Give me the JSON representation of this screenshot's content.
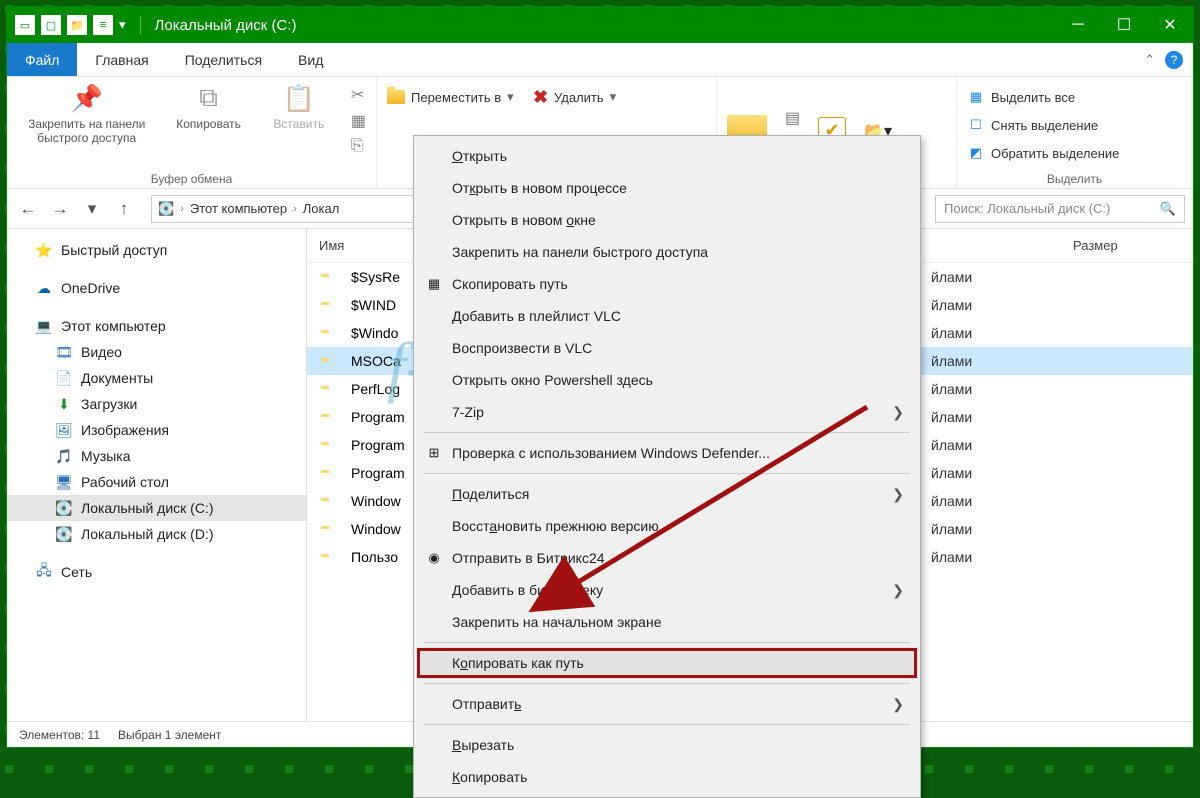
{
  "titlebar": {
    "title": "Локальный диск (C:)"
  },
  "menutabs": [
    "Файл",
    "Главная",
    "Поделиться",
    "Вид"
  ],
  "ribbon": {
    "g1": {
      "pin": "Закрепить на панели быстрого доступа",
      "copy": "Копировать",
      "paste": "Вставить",
      "label": "Буфер обмена"
    },
    "g2": {
      "move": "Переместить в",
      "delete": "Удалить"
    },
    "g3": {
      "selall": "Выделить все",
      "selnone": "Снять выделение",
      "selinv": "Обратить выделение",
      "label": "Выделить"
    }
  },
  "breadcrumb": [
    "Этот компьютер",
    "Локал"
  ],
  "search_placeholder": "Поиск: Локальный диск (C:)",
  "columns": {
    "name": "Имя",
    "size": "Размер"
  },
  "sidebar": [
    {
      "txt": "Быстрый доступ",
      "ico": "⭐",
      "lvl": 1,
      "color": "#2f8ad8"
    },
    {
      "spacer": true
    },
    {
      "txt": "OneDrive",
      "ico": "☁",
      "lvl": 1,
      "color": "#0a64a4"
    },
    {
      "spacer": true
    },
    {
      "txt": "Этот компьютер",
      "ico": "💻",
      "lvl": 1,
      "color": "#2970b8"
    },
    {
      "txt": "Видео",
      "ico": "🎞",
      "lvl": 2,
      "color": "#2970b8"
    },
    {
      "txt": "Документы",
      "ico": "📄",
      "lvl": 2,
      "color": "#3a6aa0"
    },
    {
      "txt": "Загрузки",
      "ico": "⬇",
      "lvl": 2,
      "color": "#2b8a2b"
    },
    {
      "txt": "Изображения",
      "ico": "🖼",
      "lvl": 2,
      "color": "#2970b8"
    },
    {
      "txt": "Музыка",
      "ico": "🎵",
      "lvl": 2,
      "color": "#2f8ad8"
    },
    {
      "txt": "Рабочий стол",
      "ico": "🖥",
      "lvl": 2,
      "color": "#2970b8"
    },
    {
      "txt": "Локальный диск (C:)",
      "ico": "💽",
      "lvl": 2,
      "sel": true
    },
    {
      "txt": "Локальный диск (D:)",
      "ico": "💽",
      "lvl": 2
    },
    {
      "spacer": true
    },
    {
      "txt": "Сеть",
      "ico": "🖧",
      "lvl": 1,
      "color": "#2970b8"
    }
  ],
  "files": [
    {
      "name": "$SysRe",
      "type": "йлами"
    },
    {
      "name": "$WIND",
      "type": "йлами"
    },
    {
      "name": "$Windo",
      "type": "йлами"
    },
    {
      "name": "MSOCa",
      "type": "йлами",
      "sel": true
    },
    {
      "name": "PerfLog",
      "type": "йлами"
    },
    {
      "name": "Program",
      "type": "йлами"
    },
    {
      "name": "Program",
      "type": "йлами"
    },
    {
      "name": "Program",
      "type": "йлами"
    },
    {
      "name": "Window",
      "type": "йлами"
    },
    {
      "name": "Window",
      "type": "йлами"
    },
    {
      "name": "Пользо",
      "type": "йлами"
    }
  ],
  "context_menu": [
    {
      "txt": "Открыть",
      "u": 0
    },
    {
      "txt": "Открыть в новом процессе",
      "u": 2
    },
    {
      "txt": "Открыть в новом окне",
      "u": 16
    },
    {
      "txt": "Закрепить на панели быстрого доступа"
    },
    {
      "txt": "Скопировать путь",
      "ico": "▦"
    },
    {
      "txt": "Добавить в плейлист VLC"
    },
    {
      "txt": "Воспроизвести в VLC"
    },
    {
      "txt": "Открыть окно Powershell здесь"
    },
    {
      "txt": "7-Zip",
      "sub": true
    },
    {
      "sep": true
    },
    {
      "txt": "Проверка с использованием Windows Defender...",
      "ico": "⊞"
    },
    {
      "sep": true
    },
    {
      "txt": "Поделиться",
      "u": 0,
      "sub": true
    },
    {
      "txt": "Восстановить прежнюю версию",
      "u": 5
    },
    {
      "txt": "Отправить в Битрикс24",
      "ico": "◉"
    },
    {
      "txt": "Добавить в библиотеку",
      "u": 17,
      "sub": true
    },
    {
      "txt": "Закрепить на начальном экране"
    },
    {
      "sep": true
    },
    {
      "txt": "Копировать как путь",
      "u": 1,
      "hl": true
    },
    {
      "sep": true
    },
    {
      "txt": "Отправить",
      "u": 8,
      "sub": true
    },
    {
      "sep": true
    },
    {
      "txt": "Вырезать",
      "u": 0
    },
    {
      "txt": "Копировать",
      "u": 0
    }
  ],
  "status": {
    "count": "Элементов: 11",
    "sel": "Выбран 1 элемент"
  },
  "watermark": "f-ek.com"
}
